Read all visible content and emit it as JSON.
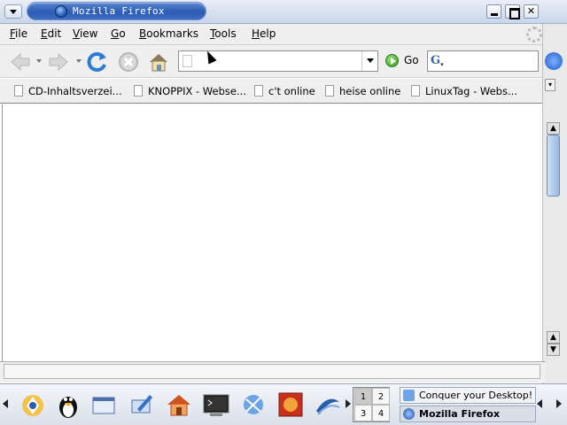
{
  "window": {
    "title": "Mozilla Firefox"
  },
  "menu": {
    "items": [
      {
        "label": "File",
        "u": "F",
        "rest": "ile"
      },
      {
        "label": "Edit",
        "u": "E",
        "rest": "dit"
      },
      {
        "label": "View",
        "u": "V",
        "rest": "iew"
      },
      {
        "label": "Go",
        "u": "G",
        "rest": "o"
      },
      {
        "label": "Bookmarks",
        "u": "B",
        "rest": "ookmarks"
      },
      {
        "label": "Tools",
        "u": "T",
        "rest": "ools"
      },
      {
        "label": "Help",
        "u": "H",
        "rest": "elp"
      }
    ]
  },
  "navigation": {
    "url_value": "",
    "go_label": "Go",
    "search_value": ""
  },
  "bookmarks": {
    "items": [
      "CD-Inhaltsverzei...",
      "KNOPPIX - Webse...",
      "c't online",
      "heise online",
      "LinuxTag - Webs..."
    ]
  },
  "statusbar": {
    "text": ""
  },
  "taskbar": {
    "pager": [
      "1",
      "2",
      "3",
      "4"
    ],
    "tasks": [
      {
        "label": "Conquer your Desktop! - Ko",
        "icon": "konqueror-icon"
      },
      {
        "label": "Mozilla Firefox",
        "icon": "firefox-icon"
      }
    ]
  },
  "colors": {
    "titlebar_accent": "#2d5cb4",
    "chrome_bg": "#efefef"
  }
}
